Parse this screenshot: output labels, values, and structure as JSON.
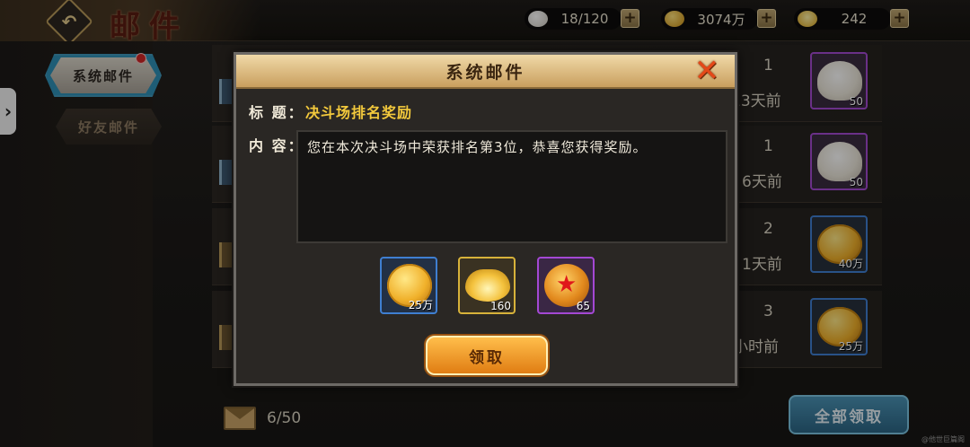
{
  "header": {
    "page_title": "邮件",
    "resources": [
      {
        "icon": "bun-icon",
        "value": "18/120"
      },
      {
        "icon": "coin-icon",
        "value": "3074万"
      },
      {
        "icon": "ingot-icon",
        "value": "242"
      }
    ]
  },
  "sidebar": {
    "tabs": [
      {
        "label": "系统邮件",
        "selected": true,
        "has_notification": true
      },
      {
        "label": "好友邮件",
        "selected": false
      }
    ]
  },
  "mail_list": {
    "rows": [
      {
        "count": "1",
        "time": "13天前",
        "item": "bun",
        "item_num": "50"
      },
      {
        "count": "1",
        "time": "6天前",
        "item": "bun",
        "item_num": "50"
      },
      {
        "count": "2",
        "time": "1天前",
        "item": "coin",
        "item_num": "40万"
      },
      {
        "count": "3",
        "time": "小时前",
        "item": "coin",
        "item_num": "25万"
      }
    ]
  },
  "footer": {
    "mail_count": "6/50",
    "claim_all_label": "全部领取",
    "watermark": "@他世巨篇阁"
  },
  "modal": {
    "title": "系统邮件",
    "subject_label": "标 题：",
    "subject": "决斗场排名奖励",
    "content_label": "内 容：",
    "content": "您在本次决斗场中荣获排名第3位，恭喜您获得奖励。",
    "rewards": [
      {
        "icon": "gold-coin-icon",
        "amount": "25万",
        "rarity": "blue"
      },
      {
        "icon": "gold-ingot-icon",
        "amount": "160",
        "rarity": "gold"
      },
      {
        "icon": "star-medal-icon",
        "amount": "65",
        "rarity": "purple"
      }
    ],
    "claim_label": "领取",
    "close_icon": "close-icon"
  }
}
